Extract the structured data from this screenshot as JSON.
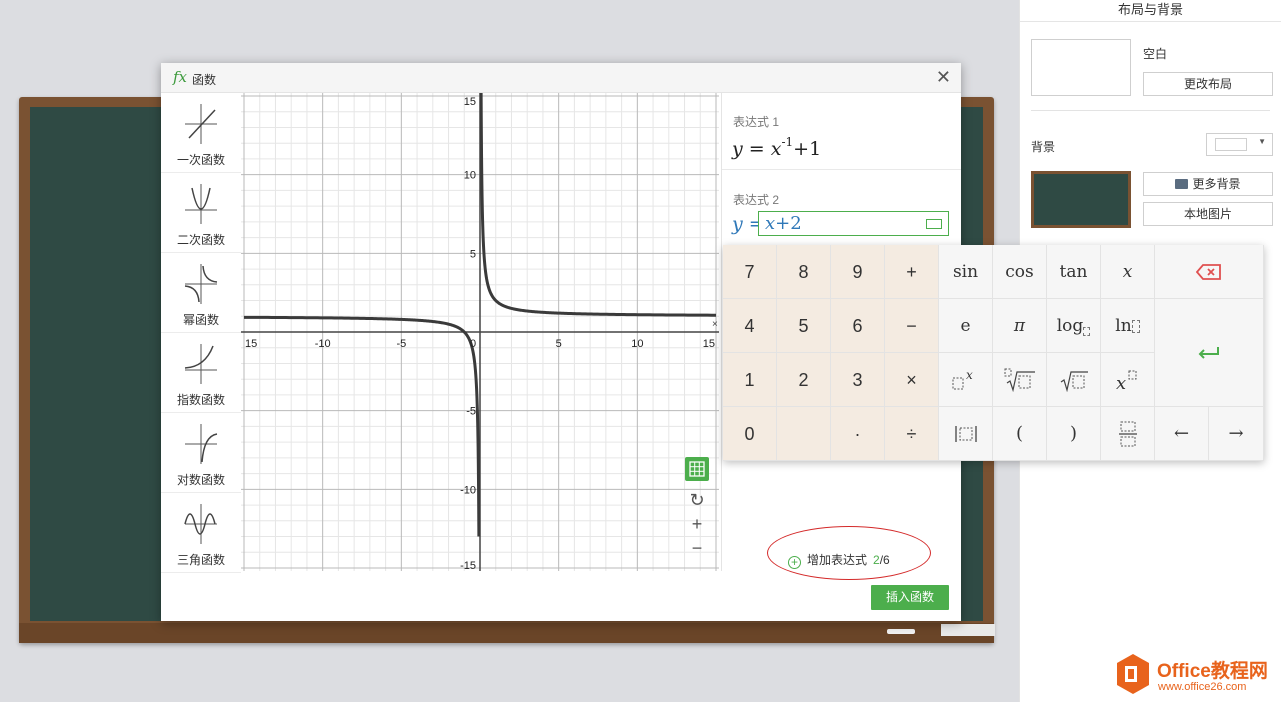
{
  "right_panel": {
    "title": "布局与背景",
    "layout_name": "空白",
    "change_layout_button": "更改布局",
    "background_label": "背景",
    "more_backgrounds_button": "更多背景",
    "local_image_button": "本地图片"
  },
  "dialog": {
    "title_icon": "fx",
    "title": "函数",
    "close_glyph": "✕",
    "categories": [
      {
        "label": "一次函数",
        "icon": "linear-function-icon"
      },
      {
        "label": "二次函数",
        "icon": "quadratic-function-icon"
      },
      {
        "label": "幂函数",
        "icon": "power-function-icon"
      },
      {
        "label": "指数函数",
        "icon": "exponential-function-icon"
      },
      {
        "label": "对数函数",
        "icon": "logarithmic-function-icon"
      },
      {
        "label": "三角函数",
        "icon": "trigonometric-function-icon"
      }
    ],
    "graph": {
      "x_ticks": [
        "15",
        "-10",
        "-5",
        "0",
        "5",
        "10",
        "15"
      ],
      "y_ticks": [
        "15",
        "10",
        "5",
        "-5",
        "-10",
        "-15"
      ],
      "x_range": [
        -15,
        15
      ],
      "y_range": [
        -15,
        15
      ],
      "grid": true,
      "curve_formula": "y = x^-1 + 1"
    },
    "tools": {
      "grid_toggle_icon": "grid-icon",
      "reset_glyph": "↻",
      "zoom_in_glyph": "+",
      "zoom_out_glyph": "−"
    },
    "expressions": [
      {
        "label": "表达式 1",
        "y": "y",
        "eq": "=",
        "x": "x",
        "exponent": "-1",
        "rest": "+1"
      },
      {
        "label": "表达式 2",
        "y": "y =",
        "x": "x",
        "rest": "+2"
      }
    ],
    "add_expression": {
      "label": "增加表达式",
      "count": "2",
      "total": "/6"
    },
    "insert_button": "插入函数"
  },
  "keypad": {
    "keys": {
      "k7": "7",
      "k8": "8",
      "k9": "9",
      "plus": "+",
      "k4": "4",
      "k5": "5",
      "k6": "6",
      "minus": "−",
      "k1": "1",
      "k2": "2",
      "k3": "3",
      "times": "×",
      "k0": "0",
      "dot": "·",
      "divide": "÷",
      "sin": "sin",
      "cos": "cos",
      "tan": "tan",
      "x": "x",
      "e": "e",
      "pi": "π",
      "log": "log",
      "ln": "ln",
      "lparen": "(",
      "rparen": ")",
      "left": "←",
      "right": "→",
      "enter": "↵"
    }
  },
  "watermark": {
    "line1": "Office教程网",
    "line2": "www.office26.com"
  }
}
